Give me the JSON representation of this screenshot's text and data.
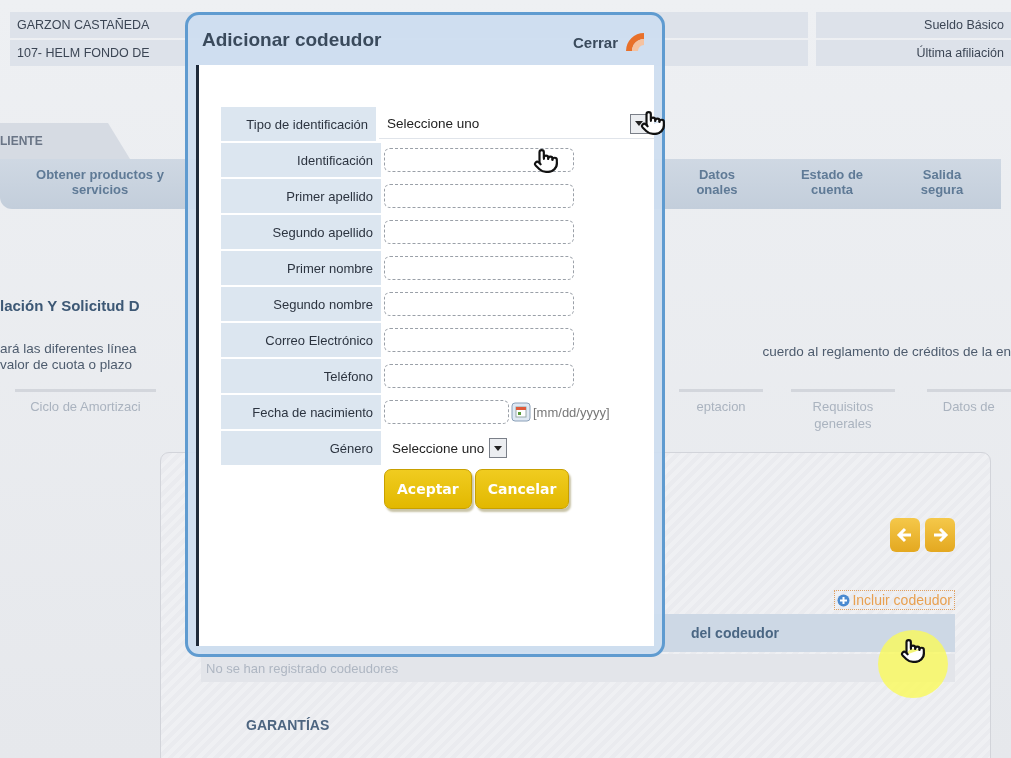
{
  "info_bar": {
    "rows": [
      {
        "left": "GARZON CASTAÑEDA",
        "right": "Sueldo Básico"
      },
      {
        "left": "107- HELM FONDO DE",
        "right": "Última afiliación"
      }
    ]
  },
  "client_tab": {
    "label": "LIENTE"
  },
  "nav": {
    "items": [
      {
        "label": "Obtener productos y servicios"
      },
      {
        "label": "Datos onales"
      },
      {
        "label": "Estado de cuenta"
      },
      {
        "label": "Salida segura"
      }
    ]
  },
  "section": {
    "title": "lación Y Solicitud D",
    "text_left": [
      "ará las diferentes línea",
      "valor de cuota o plazo"
    ],
    "text_right": "cuerdo al reglamento de créditos de la en"
  },
  "steps": [
    {
      "label": "Ciclo de Amortizaci"
    },
    {
      "label": "eptacion"
    },
    {
      "label": "Requisitos generales"
    },
    {
      "label": "Datos de"
    }
  ],
  "codebtors": {
    "add_link": "Incluir codeudor",
    "column": "del codeudor",
    "empty": "No se han registrado codeudores",
    "next_section": "GARANTÍAS"
  },
  "dialog": {
    "title": "Adicionar codeudor",
    "close": "Cerrar",
    "fields": [
      {
        "label": "Tipo de identificación",
        "kind": "select",
        "value": "Seleccione uno"
      },
      {
        "label": "Identificación",
        "kind": "text"
      },
      {
        "label": "Primer apellido",
        "kind": "text"
      },
      {
        "label": "Segundo apellido",
        "kind": "text"
      },
      {
        "label": "Primer nombre",
        "kind": "text"
      },
      {
        "label": "Segundo nombre",
        "kind": "text"
      },
      {
        "label": "Correo Electrónico",
        "kind": "text"
      },
      {
        "label": "Teléfono",
        "kind": "text"
      },
      {
        "label": "Fecha de nacimiento",
        "kind": "date",
        "hint": "[mm/dd/yyyy]"
      },
      {
        "label": "Género",
        "kind": "compact-select",
        "value": "Seleccione uno"
      }
    ],
    "buttons": [
      "Aceptar",
      "Cancelar"
    ]
  }
}
